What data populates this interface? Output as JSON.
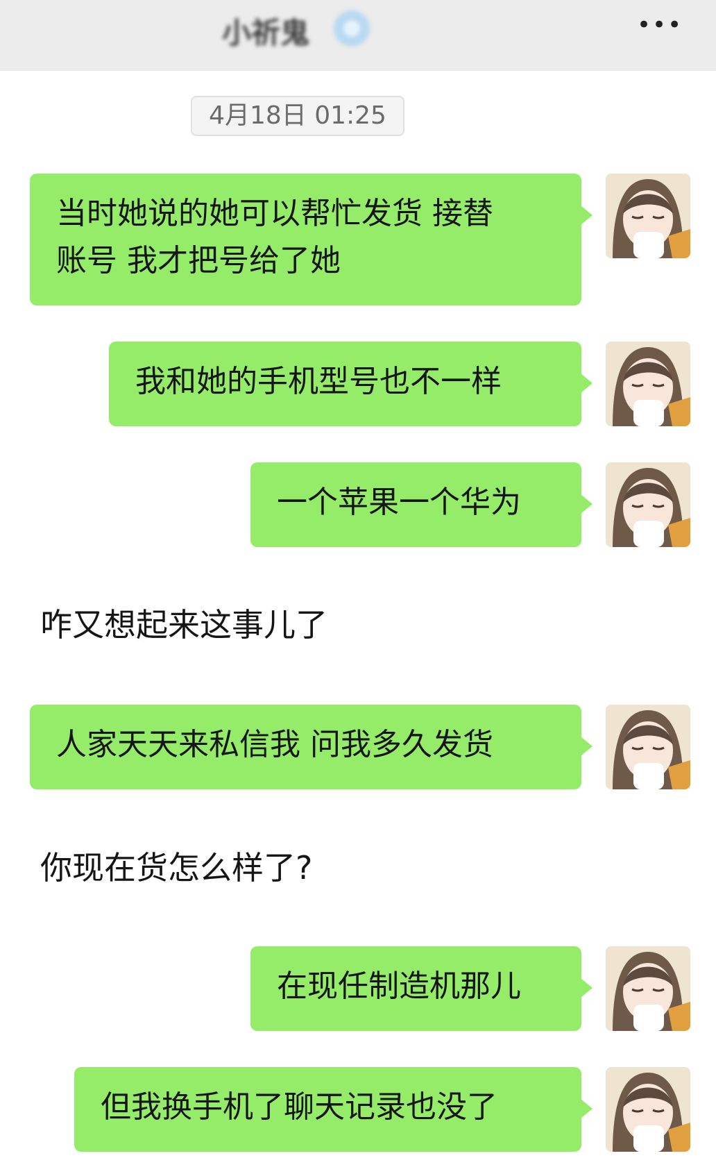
{
  "header": {
    "contact_name": "小祈鬼",
    "more_label": "•••"
  },
  "timestamp": "4月18日 01:25",
  "messages": [
    {
      "side": "right",
      "lines": [
        "当时她说的她可以帮忙发货 接替",
        "账号 我才把号给了她"
      ]
    },
    {
      "side": "right",
      "lines": [
        "我和她的手机型号也不一样"
      ]
    },
    {
      "side": "right",
      "lines": [
        "一个苹果一个华为"
      ]
    },
    {
      "side": "left",
      "lines": [
        "咋又想起来这事儿了"
      ]
    },
    {
      "side": "right",
      "lines": [
        "人家天天来私信我 问我多久发货"
      ]
    },
    {
      "side": "left",
      "lines": [
        "你现在货怎么样了?"
      ]
    },
    {
      "side": "right",
      "lines": [
        "在现任制造机那儿"
      ]
    },
    {
      "side": "right",
      "lines": [
        "但我换手机了聊天记录也没了"
      ]
    }
  ],
  "colors": {
    "bubble_green": "#95ec69",
    "header_bg": "#ececec"
  },
  "icons": {
    "more": "more-dots-icon",
    "avatar": "anime-girl-avatar",
    "name_emoji": "snowflake-emoji"
  }
}
